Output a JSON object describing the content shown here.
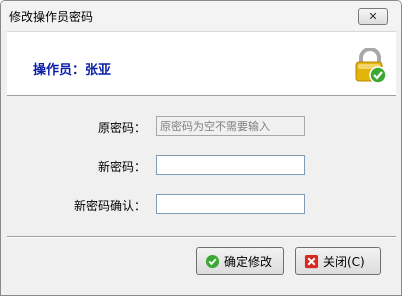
{
  "window": {
    "title": "修改操作员密码",
    "close_glyph": "✕"
  },
  "header": {
    "operator_label": "操作员：张亚"
  },
  "form": {
    "old_password": {
      "label": "原密码：",
      "value": "",
      "placeholder": "原密码为空不需要输入"
    },
    "new_password": {
      "label": "新密码：",
      "value": ""
    },
    "confirm_password": {
      "label": "新密码确认：",
      "value": ""
    }
  },
  "buttons": {
    "confirm_label": "确定修改",
    "close_label": "关闭(C)"
  },
  "icons": {
    "lock": "lock-check-icon",
    "confirm": "check-circle-icon",
    "close": "red-x-icon"
  },
  "colors": {
    "operator_text": "#0a1ea6",
    "check_green": "#3aa832",
    "close_red": "#d42a1f",
    "lock_gold": "#e3b40c"
  }
}
